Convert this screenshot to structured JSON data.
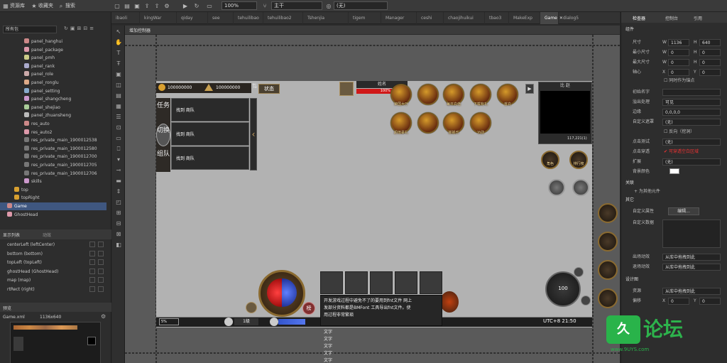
{
  "toolbar": {
    "items": [
      "资源库",
      "收藏夹",
      "搜索"
    ],
    "zoom": "100%",
    "layer": "主干",
    "other": "(无)"
  },
  "tabs": [
    "ibaoli",
    "kingWar",
    "qiday",
    "see",
    "tehuilibao",
    "tehuilibao2",
    "Tshenjia",
    "tigem",
    "Manager",
    "ceshi",
    "chaojihuikui",
    "tbao3",
    "MakeExp",
    "Game",
    "dialog5"
  ],
  "active_tab": "Game",
  "left": {
    "filter": "所有包",
    "tree": [
      "panel_hanghui",
      "panel_package",
      "panel_pmh",
      "panel_rank",
      "panel_role",
      "panel_ronglu",
      "panel_setting",
      "panel_shangcheng",
      "panel_shejiao",
      "panel_zhuansheng",
      "res_auto",
      "res_auto2",
      "res_private_main_1900012538",
      "res_private_main_1900012580",
      "res_private_main_1900012700",
      "res_private_main_1900012705",
      "res_private_main_1900012706",
      "skills",
      "top",
      "topRight",
      "Game",
      "GhostHead"
    ],
    "display_list_title": "显示列表",
    "display_list_tab2": "动效",
    "display_items": [
      "centerLeft (leftCenter)",
      "bottom (bottom)",
      "topLeft (topLeft)",
      "ghostHead (GhostHead)",
      "map (map)",
      "rtRect (right)"
    ],
    "preview_title": "预览",
    "preview_file": "Game.xml",
    "preview_size": "1136x640"
  },
  "stage": {
    "add_controller": "增加控制器",
    "gold": "100000000",
    "silver": "100000000",
    "status_btn": "状态",
    "name_label": "姓名",
    "hp_pct": "100%",
    "minimap_title": "比 赵",
    "minimap_coords": "117,221(1)",
    "minimap_map": "",
    "side_tabs": [
      {
        "label": "任务"
      },
      {
        "label": "切换"
      },
      {
        "label": "组队"
      }
    ],
    "task_rows": [
      "找到 商队",
      "找到 商队",
      "找到 商队"
    ],
    "icons_row1": [
      "荣国大厅",
      "",
      "每日充值",
      "下载有礼",
      "首充"
    ],
    "icons_row2": [
      "超值豪礼",
      "",
      "摇摇乐",
      "功勋"
    ],
    "round_buttons": [
      "角色",
      "排行榜"
    ],
    "level": "1级",
    "hp_bar_text": "",
    "exp_text": "5%",
    "time": "UTC+8  21:50",
    "joystick_val": "100",
    "bag_label": "榜",
    "tooltip_lines": [
      "开发游戏过程中避免不了的要用到fnt文件 网上",
      "发部分资料都是BMFont 工具导出fnt文件。使",
      "用过程非常繁琐"
    ],
    "text_list": [
      "文字",
      "文字",
      "文字",
      "文字",
      "文字"
    ]
  },
  "right": {
    "tabs": [
      "检查器",
      "控制台",
      "引用"
    ],
    "component": "组件",
    "size_label": "尺寸",
    "size_w": "1136",
    "size_h": "640",
    "min_label": "最小尺寸",
    "min_w": "0",
    "min_h": "0",
    "max_label": "最大尺寸",
    "max_w": "0",
    "max_h": "0",
    "pivot_label": "轴心",
    "pivot_x": "0",
    "pivot_y": "0",
    "pivot_anchor": "同时作为锚点",
    "init_name_label": "初始名字",
    "overflow_label": "溢出处理",
    "overflow_val": "可见",
    "margin_label": "边缘",
    "margin_val": "0,0,0,0",
    "mask_label": "自定义遮罩",
    "mask_val": "(无)",
    "reverse_label": "反向（挖洞）",
    "click_label": "点击测试",
    "click_val": "(无)",
    "click_through_label": "点击穿透",
    "click_through_val": "可穿透空白区域",
    "ext_label": "扩展",
    "ext_val": "(无)",
    "bg_label": "背景颜色",
    "relation": "关联",
    "add_relation": "+ 为其他元件",
    "other": "其它",
    "custom_prop": "自定义属性",
    "edit_btn": "编辑...",
    "custom_data": "自定义数据",
    "enter_anim": "出场动效",
    "enter_val": "从库中拖拽到此",
    "exit_anim": "退场动效",
    "exit_val": "从库中拖拽到此",
    "design": "设计图",
    "res_label": "资源",
    "res_val": "从库中拖拽到此",
    "offset_label": "偏移",
    "offset_x": "0",
    "offset_y": "0"
  },
  "watermark": {
    "brand": "论坛",
    "url": "www.9UYS.com"
  }
}
